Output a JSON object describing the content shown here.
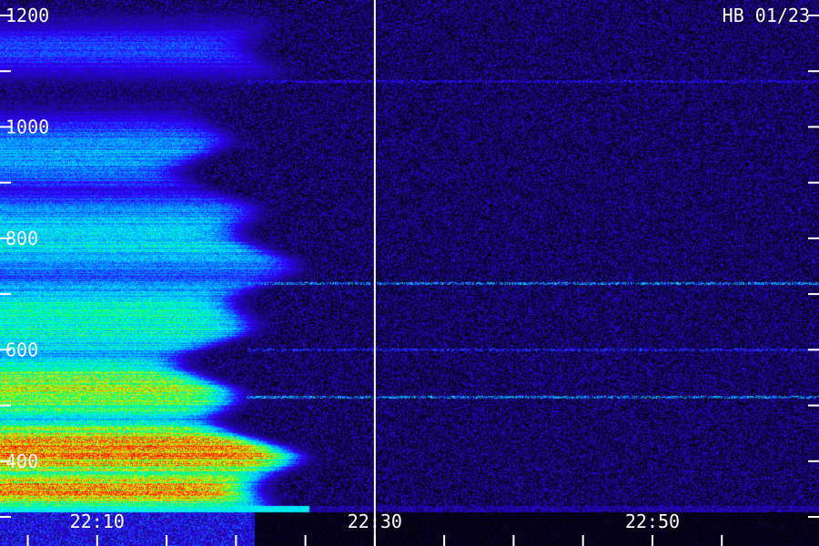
{
  "chart_data": {
    "type": "heatmap",
    "title": "",
    "corner_label": "HB 01/23",
    "xlabel": "",
    "ylabel": "",
    "x_tick_labels": [
      "22:10",
      "22:30",
      "22:50"
    ],
    "x_range_minutes": [
      "22:03",
      "22:62"
    ],
    "x_tick_minutes": [
      10,
      30,
      50
    ],
    "x_minor_tick_minutes": [
      5,
      10,
      15,
      20,
      25,
      30,
      35,
      40,
      45,
      50,
      55
    ],
    "y_tick_labels": [
      "1200",
      "1000",
      "800",
      "600",
      "400"
    ],
    "y_tick_values": [
      1200,
      1000,
      800,
      600,
      400
    ],
    "y_minor_tick_values": [
      1100,
      900,
      700,
      500,
      300
    ],
    "ylim": [
      220,
      1200
    ],
    "marker_time": "22:30",
    "colormap": [
      "#000000",
      "#1a0a80",
      "#3000ff",
      "#0090ff",
      "#00f0ff",
      "#00ff60",
      "#d0ff00",
      "#ffa000",
      "#ff1000"
    ],
    "emission_band": {
      "end_time": "22:20",
      "components": [
        {
          "center": 350,
          "width": 45,
          "intensity": 0.85
        },
        {
          "center": 420,
          "width": 70,
          "intensity": 0.9
        },
        {
          "center": 530,
          "width": 80,
          "intensity": 0.72
        },
        {
          "center": 650,
          "width": 110,
          "intensity": 0.55
        },
        {
          "center": 800,
          "width": 100,
          "intensity": 0.48
        },
        {
          "center": 950,
          "width": 80,
          "intensity": 0.42
        },
        {
          "center": 1140,
          "width": 60,
          "intensity": 0.3
        }
      ]
    },
    "interference_lines": [
      {
        "freq": 720,
        "intensity": 0.5
      },
      {
        "freq": 600,
        "intensity": 0.35
      },
      {
        "freq": 515,
        "intensity": 0.5
      },
      {
        "freq": 1083,
        "intensity": 0.3
      },
      {
        "freq": 240,
        "intensity": 0.7
      }
    ],
    "noise_floor": 0.12
  }
}
